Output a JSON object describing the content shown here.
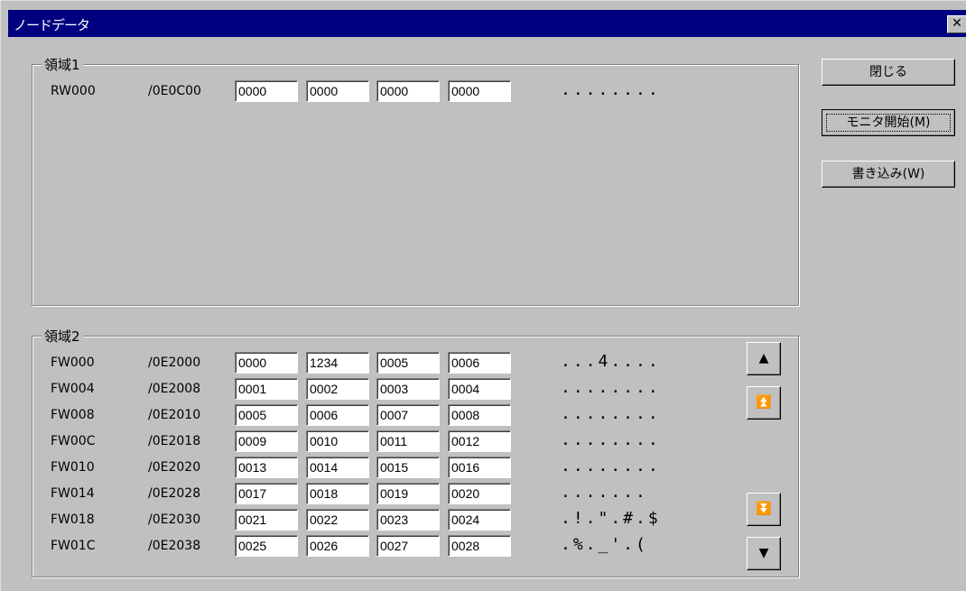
{
  "window": {
    "title": "ノードデータ",
    "close_glyph": "✕"
  },
  "buttons": {
    "close_label": "閉じる",
    "monitor_label": "モニタ開始(M)",
    "write_label": "書き込み(W)"
  },
  "area1": {
    "label": "領域1",
    "rows": [
      {
        "addr": "RW000",
        "phys": "/0E0C00",
        "cells": [
          "0000",
          "0000",
          "0000",
          "0000"
        ],
        "ascii": "........"
      }
    ]
  },
  "area2": {
    "label": "領域2",
    "rows": [
      {
        "addr": "FW000",
        "phys": "/0E2000",
        "cells": [
          "0000",
          "1234",
          "0005",
          "0006"
        ],
        "ascii": "...4...."
      },
      {
        "addr": "FW004",
        "phys": "/0E2008",
        "cells": [
          "0001",
          "0002",
          "0003",
          "0004"
        ],
        "ascii": "........"
      },
      {
        "addr": "FW008",
        "phys": "/0E2010",
        "cells": [
          "0005",
          "0006",
          "0007",
          "0008"
        ],
        "ascii": "........"
      },
      {
        "addr": "FW00C",
        "phys": "/0E2018",
        "cells": [
          "0009",
          "0010",
          "0011",
          "0012"
        ],
        "ascii": "........"
      },
      {
        "addr": "FW010",
        "phys": "/0E2020",
        "cells": [
          "0013",
          "0014",
          "0015",
          "0016"
        ],
        "ascii": "........"
      },
      {
        "addr": "FW014",
        "phys": "/0E2028",
        "cells": [
          "0017",
          "0018",
          "0019",
          "0020"
        ],
        "ascii": "......."
      },
      {
        "addr": "FW018",
        "phys": "/0E2030",
        "cells": [
          "0021",
          "0022",
          "0023",
          "0024"
        ],
        "ascii": ".!.\".#.$"
      },
      {
        "addr": "FW01C",
        "phys": "/0E2038",
        "cells": [
          "0025",
          "0026",
          "0027",
          "0028"
        ],
        "ascii": ".%._'.("
      }
    ]
  },
  "scroll": {
    "up_icon": "▲",
    "page_up_icon": "⏫",
    "page_down_icon": "⏬",
    "down_icon": "▼"
  }
}
